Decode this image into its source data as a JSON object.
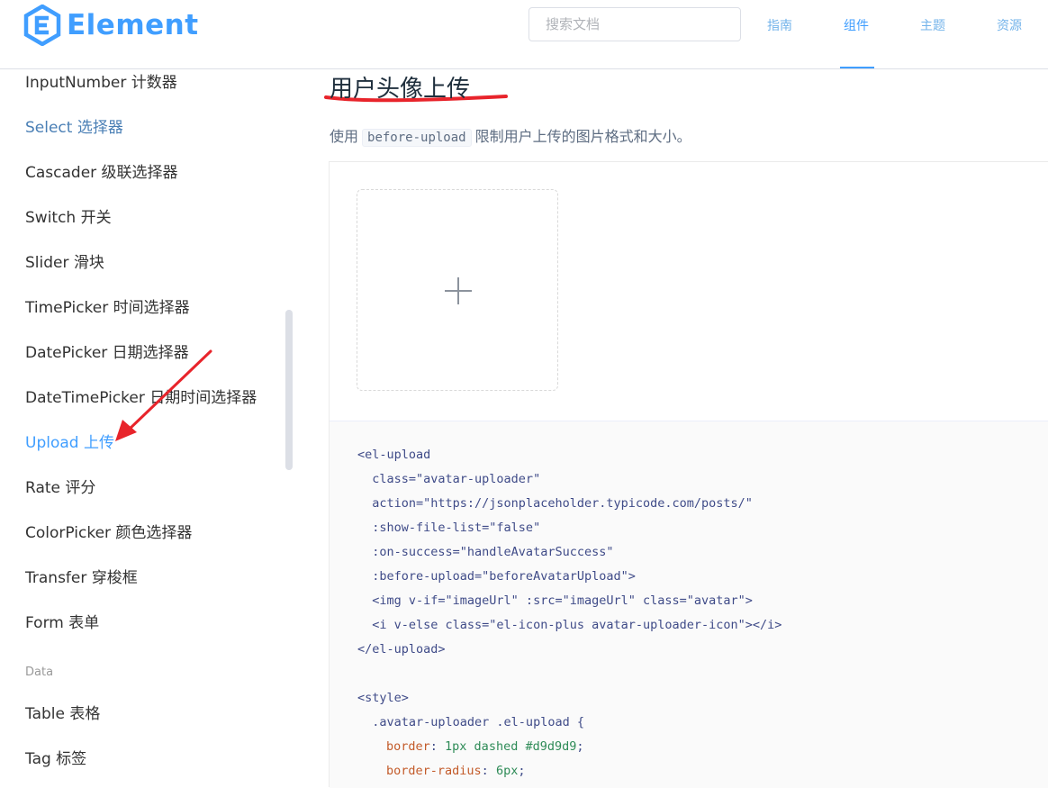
{
  "header": {
    "brand": "Element",
    "search_placeholder": "搜索文档",
    "nav": [
      "指南",
      "组件",
      "主题",
      "资源"
    ],
    "nav_active": "组件"
  },
  "sidebar": {
    "items": [
      "InputNumber 计数器",
      "Select 选择器",
      "Cascader 级联选择器",
      "Switch 开关",
      "Slider 滑块",
      "TimePicker 时间选择器",
      "DatePicker 日期选择器",
      "DateTimePicker 日期时间选择器",
      "Upload 上传",
      "Rate 评分",
      "ColorPicker 颜色选择器",
      "Transfer 穿梭框",
      "Form 表单"
    ],
    "active_item": "Upload 上传",
    "group_label": "Data",
    "data_items": [
      "Table 表格",
      "Tag 标签"
    ]
  },
  "main": {
    "title": "用户头像上传",
    "desc_before": "使用",
    "desc_code": "before-upload",
    "desc_after": "限制用户上传的图片格式和大小。"
  },
  "code": {
    "l1": "<el-upload",
    "l2": "  class=\"avatar-uploader\"",
    "l3": "  action=\"https://jsonplaceholder.typicode.com/posts/\"",
    "l4": "  :show-file-list=\"false\"",
    "l5": "  :on-success=\"handleAvatarSuccess\"",
    "l6": "  :before-upload=\"beforeAvatarUpload\">",
    "l7": "  <img v-if=\"imageUrl\" :src=\"imageUrl\" class=\"avatar\">",
    "l8": "  <i v-else class=\"el-icon-plus avatar-uploader-icon\"></i>",
    "l9": "</el-upload>",
    "l10": "<style>",
    "l11": "  .avatar-uploader .el-upload {",
    "l12_prop": "border",
    "l12_val": "1px dashed #d9d9d9",
    "l13_prop": "border-radius",
    "l13_val": "6px"
  },
  "colors": {
    "accent": "#409eff",
    "annotation": "#e8242b"
  }
}
